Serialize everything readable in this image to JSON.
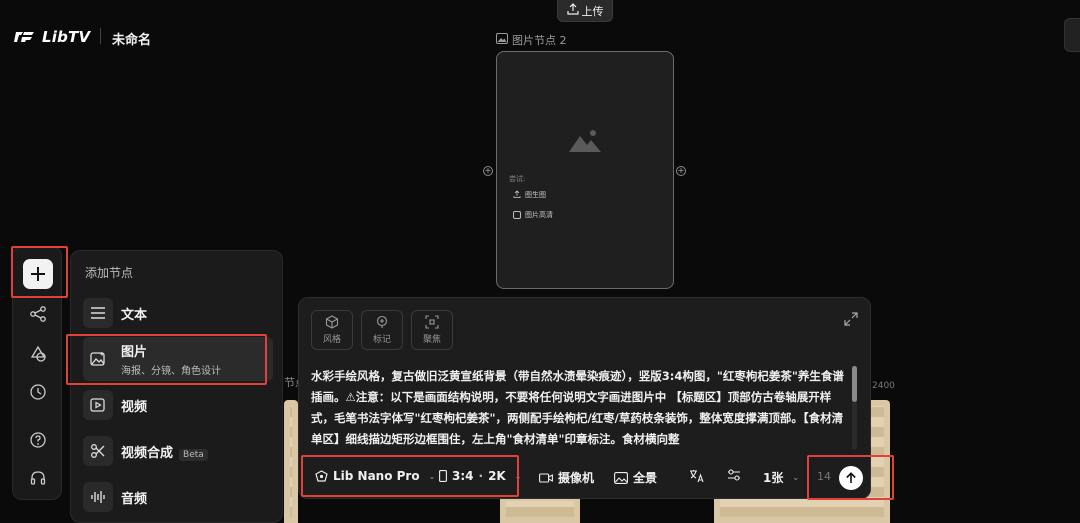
{
  "header": {
    "logo_text": "LibTV",
    "project_name": "未命名",
    "upload_label": "上传"
  },
  "canvas": {
    "node_title": "图片节点 2",
    "node_hint": "尝试:",
    "node_actions": [
      "图生图",
      "图片高清"
    ],
    "behind_label_left": "节点",
    "behind_label_right": "2400"
  },
  "add_panel": {
    "title": "添加节点",
    "items": [
      {
        "label": "文本",
        "sub": "",
        "icon": "text-lines-icon"
      },
      {
        "label": "图片",
        "sub": "海报、分镜、角色设计",
        "icon": "image-sparkle-icon"
      },
      {
        "label": "视频",
        "sub": "",
        "icon": "video-play-icon"
      },
      {
        "label": "视频合成",
        "sub": "",
        "badge": "Beta",
        "icon": "scissors-icon"
      },
      {
        "label": "音频",
        "sub": "",
        "icon": "audio-wave-icon"
      }
    ]
  },
  "prompt": {
    "tools": [
      "风格",
      "标记",
      "聚焦"
    ],
    "text": "水彩手绘风格，复古做旧泛黄宣纸背景（带自然水渍晕染痕迹），竖版3:4构图，\"红枣枸杞姜茶\"养生食谱插画。⚠注意：以下是画面结构说明，不要将任何说明文字画进图片中 【标题区】顶部仿古卷轴展开样式，毛笔书法字体写\"红枣枸杞姜茶\"，两侧配手绘枸杞/红枣/草药枝条装饰，整体宽度撑满顶部。【食材清单区】细线描边矩形边框围住，左上角\"食材清单\"印章标注。食材横向整",
    "model": "Lib Nano Pro",
    "ratio": "3:4",
    "resolution": "2K",
    "camera": "摄像机",
    "panorama": "全景",
    "quantity": "1张",
    "count": "14"
  },
  "colors": {
    "highlight": "#e0413a",
    "background": "#0a0a0a",
    "panel": "#1d1d1d"
  }
}
